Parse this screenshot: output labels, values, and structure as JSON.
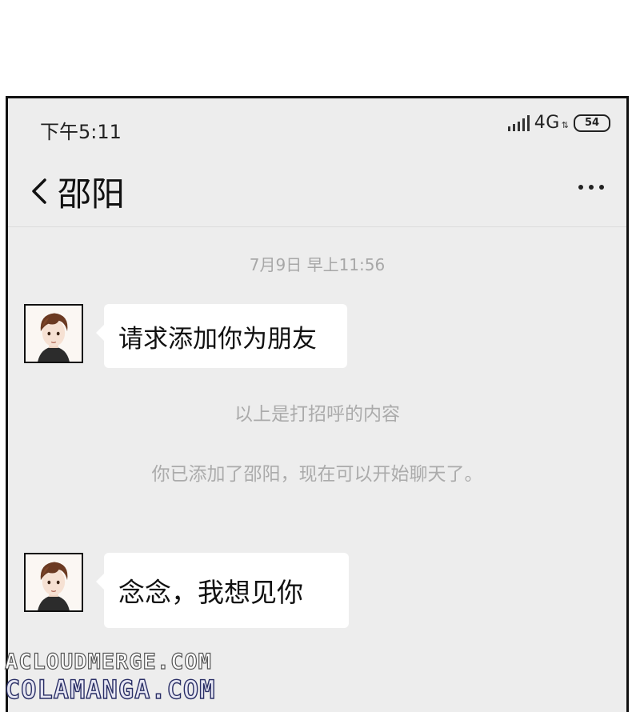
{
  "status_bar": {
    "time": "下午5:11",
    "network": "4G",
    "battery": "54"
  },
  "header": {
    "contact_name": "邵阳"
  },
  "chat": {
    "timestamp": "7月9日 早上11:56",
    "messages": [
      {
        "text": "请求添加你为朋友"
      },
      {
        "text": "念念，我想见你"
      }
    ],
    "system_notes": [
      "以上是打招呼的内容",
      "你已添加了邵阳，现在可以开始聊天了。"
    ]
  },
  "watermark": {
    "line1": "ACLOUDMERGE.COM",
    "line2": "COLAMANGA.COM"
  },
  "icons": {
    "back": "chevron-left-icon",
    "more": "more-dots-icon",
    "signal": "signal-icon",
    "battery": "battery-icon"
  }
}
